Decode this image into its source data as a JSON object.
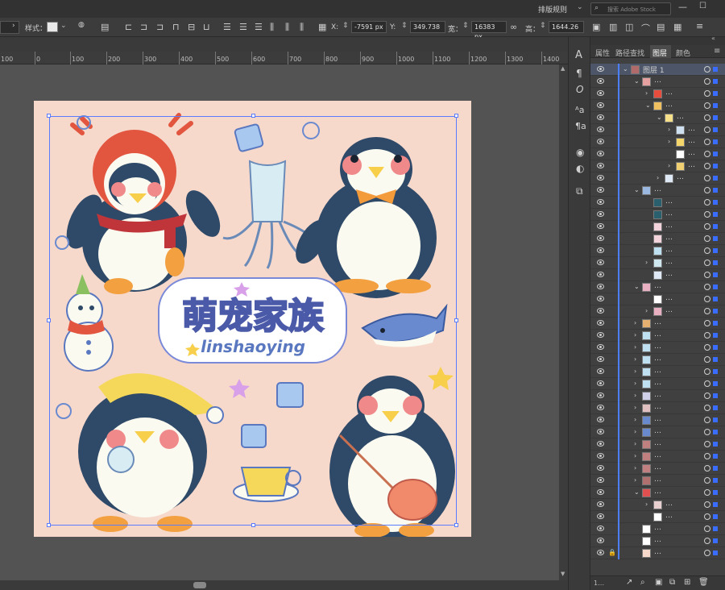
{
  "app_bar": {
    "arrange_label": "排版规则",
    "search_placeholder": "搜索 Adobe Stock"
  },
  "control_bar": {
    "style_label": "样式：",
    "x_label": "X:",
    "x_value": "-7591 px",
    "y_label": "Y:",
    "y_value": "349.738",
    "w_label": "宽：",
    "w_value": "16383 px",
    "h_label": "高：",
    "h_value": "1644.26"
  },
  "ruler_ticks": [
    "100",
    "0",
    "100",
    "200",
    "300",
    "400",
    "500",
    "600",
    "700",
    "800",
    "900",
    "1000",
    "1100",
    "1200",
    "1300",
    "1400"
  ],
  "panel_tabs": [
    "属性",
    "路径查找",
    "图层",
    "颜色"
  ],
  "active_tab": "图层",
  "layer_top_name": "图层 1",
  "layers_footer_label": "1…",
  "artboard": {
    "title_chinese": "萌宠家族",
    "title_latin": "linshaoying",
    "bg_color": "#f7d9cc"
  },
  "toolstrip_icons": [
    "character-icon",
    "paragraph-icon",
    "opentype-icon",
    "char-styles-icon",
    "para-styles-icon",
    "appearance-icon",
    "graphic-styles-icon",
    "transform-icon"
  ],
  "layers": [
    {
      "indent": 0,
      "expanded": true,
      "name": "图层 1",
      "thumb": "#b06a6a",
      "target_filled": false
    },
    {
      "indent": 1,
      "expanded": true,
      "name": "…",
      "thumb": "#e6a0a0"
    },
    {
      "indent": 2,
      "expanded": false,
      "name": "…",
      "thumb": "#e74c3c"
    },
    {
      "indent": 2,
      "expanded": true,
      "name": "…",
      "thumb": "#f0c060"
    },
    {
      "indent": 3,
      "expanded": true,
      "name": "…",
      "thumb": "#f7e08a"
    },
    {
      "indent": 4,
      "expanded": false,
      "name": "…",
      "thumb": "#cfe0f0"
    },
    {
      "indent": 4,
      "expanded": false,
      "name": "…",
      "thumb": "#f5d66a"
    },
    {
      "indent": 4,
      "expanded": null,
      "name": "…",
      "thumb": "#ffffff"
    },
    {
      "indent": 4,
      "expanded": false,
      "name": "…",
      "thumb": "#f0d070"
    },
    {
      "indent": 3,
      "expanded": false,
      "name": "…",
      "thumb": "#dfe8f5"
    },
    {
      "indent": 1,
      "expanded": true,
      "name": "…",
      "thumb": "#9ab8e0"
    },
    {
      "indent": 2,
      "expanded": null,
      "name": "…",
      "thumb": "#2a5f6e"
    },
    {
      "indent": 2,
      "expanded": null,
      "name": "…",
      "thumb": "#2a5f6e"
    },
    {
      "indent": 2,
      "expanded": null,
      "name": "…",
      "thumb": "#f3d3dc"
    },
    {
      "indent": 2,
      "expanded": null,
      "name": "…",
      "thumb": "#f3d3dc"
    },
    {
      "indent": 2,
      "expanded": null,
      "name": "…",
      "thumb": "#bfe0f0"
    },
    {
      "indent": 2,
      "expanded": false,
      "name": "…",
      "thumb": "#cfe8f0"
    },
    {
      "indent": 2,
      "expanded": null,
      "name": "…",
      "thumb": "#dfe8f5"
    },
    {
      "indent": 1,
      "expanded": true,
      "name": "…",
      "thumb": "#e8b0c0"
    },
    {
      "indent": 2,
      "expanded": null,
      "name": "…",
      "thumb": "#ffffff"
    },
    {
      "indent": 2,
      "expanded": false,
      "name": "…",
      "thumb": "#e8b0c0"
    },
    {
      "indent": 1,
      "expanded": false,
      "name": "…",
      "thumb": "#e6b070"
    },
    {
      "indent": 1,
      "expanded": false,
      "name": "…",
      "thumb": "#bfe0f0"
    },
    {
      "indent": 1,
      "expanded": false,
      "name": "…",
      "thumb": "#bfe0f0"
    },
    {
      "indent": 1,
      "expanded": false,
      "name": "…",
      "thumb": "#bfe0f0"
    },
    {
      "indent": 1,
      "expanded": false,
      "name": "…",
      "thumb": "#bfe0f0"
    },
    {
      "indent": 1,
      "expanded": false,
      "name": "…",
      "thumb": "#bfe0f0"
    },
    {
      "indent": 1,
      "expanded": false,
      "name": "…",
      "thumb": "#d0d0e8"
    },
    {
      "indent": 1,
      "expanded": false,
      "name": "…",
      "thumb": "#e0c0c0"
    },
    {
      "indent": 1,
      "expanded": false,
      "name": "…",
      "thumb": "#6a8ad0"
    },
    {
      "indent": 1,
      "expanded": false,
      "name": "…",
      "thumb": "#6a8ad0"
    },
    {
      "indent": 1,
      "expanded": false,
      "name": "…",
      "thumb": "#c08080"
    },
    {
      "indent": 1,
      "expanded": false,
      "name": "…",
      "thumb": "#c08080"
    },
    {
      "indent": 1,
      "expanded": false,
      "name": "…",
      "thumb": "#c08080"
    },
    {
      "indent": 1,
      "expanded": false,
      "name": "…",
      "thumb": "#b07070"
    },
    {
      "indent": 1,
      "expanded": true,
      "name": "…",
      "thumb": "#e05050"
    },
    {
      "indent": 2,
      "expanded": false,
      "name": "…",
      "thumb": "#e8d0d0"
    },
    {
      "indent": 2,
      "expanded": null,
      "name": "…",
      "thumb": "#ffffff"
    },
    {
      "indent": 1,
      "expanded": null,
      "name": "…",
      "thumb": "#ffffff"
    },
    {
      "indent": 1,
      "expanded": null,
      "name": "…",
      "thumb": "#ffffff"
    },
    {
      "indent": 1,
      "expanded": null,
      "name": "…",
      "thumb": "#f7d9cc",
      "locked": true
    }
  ]
}
